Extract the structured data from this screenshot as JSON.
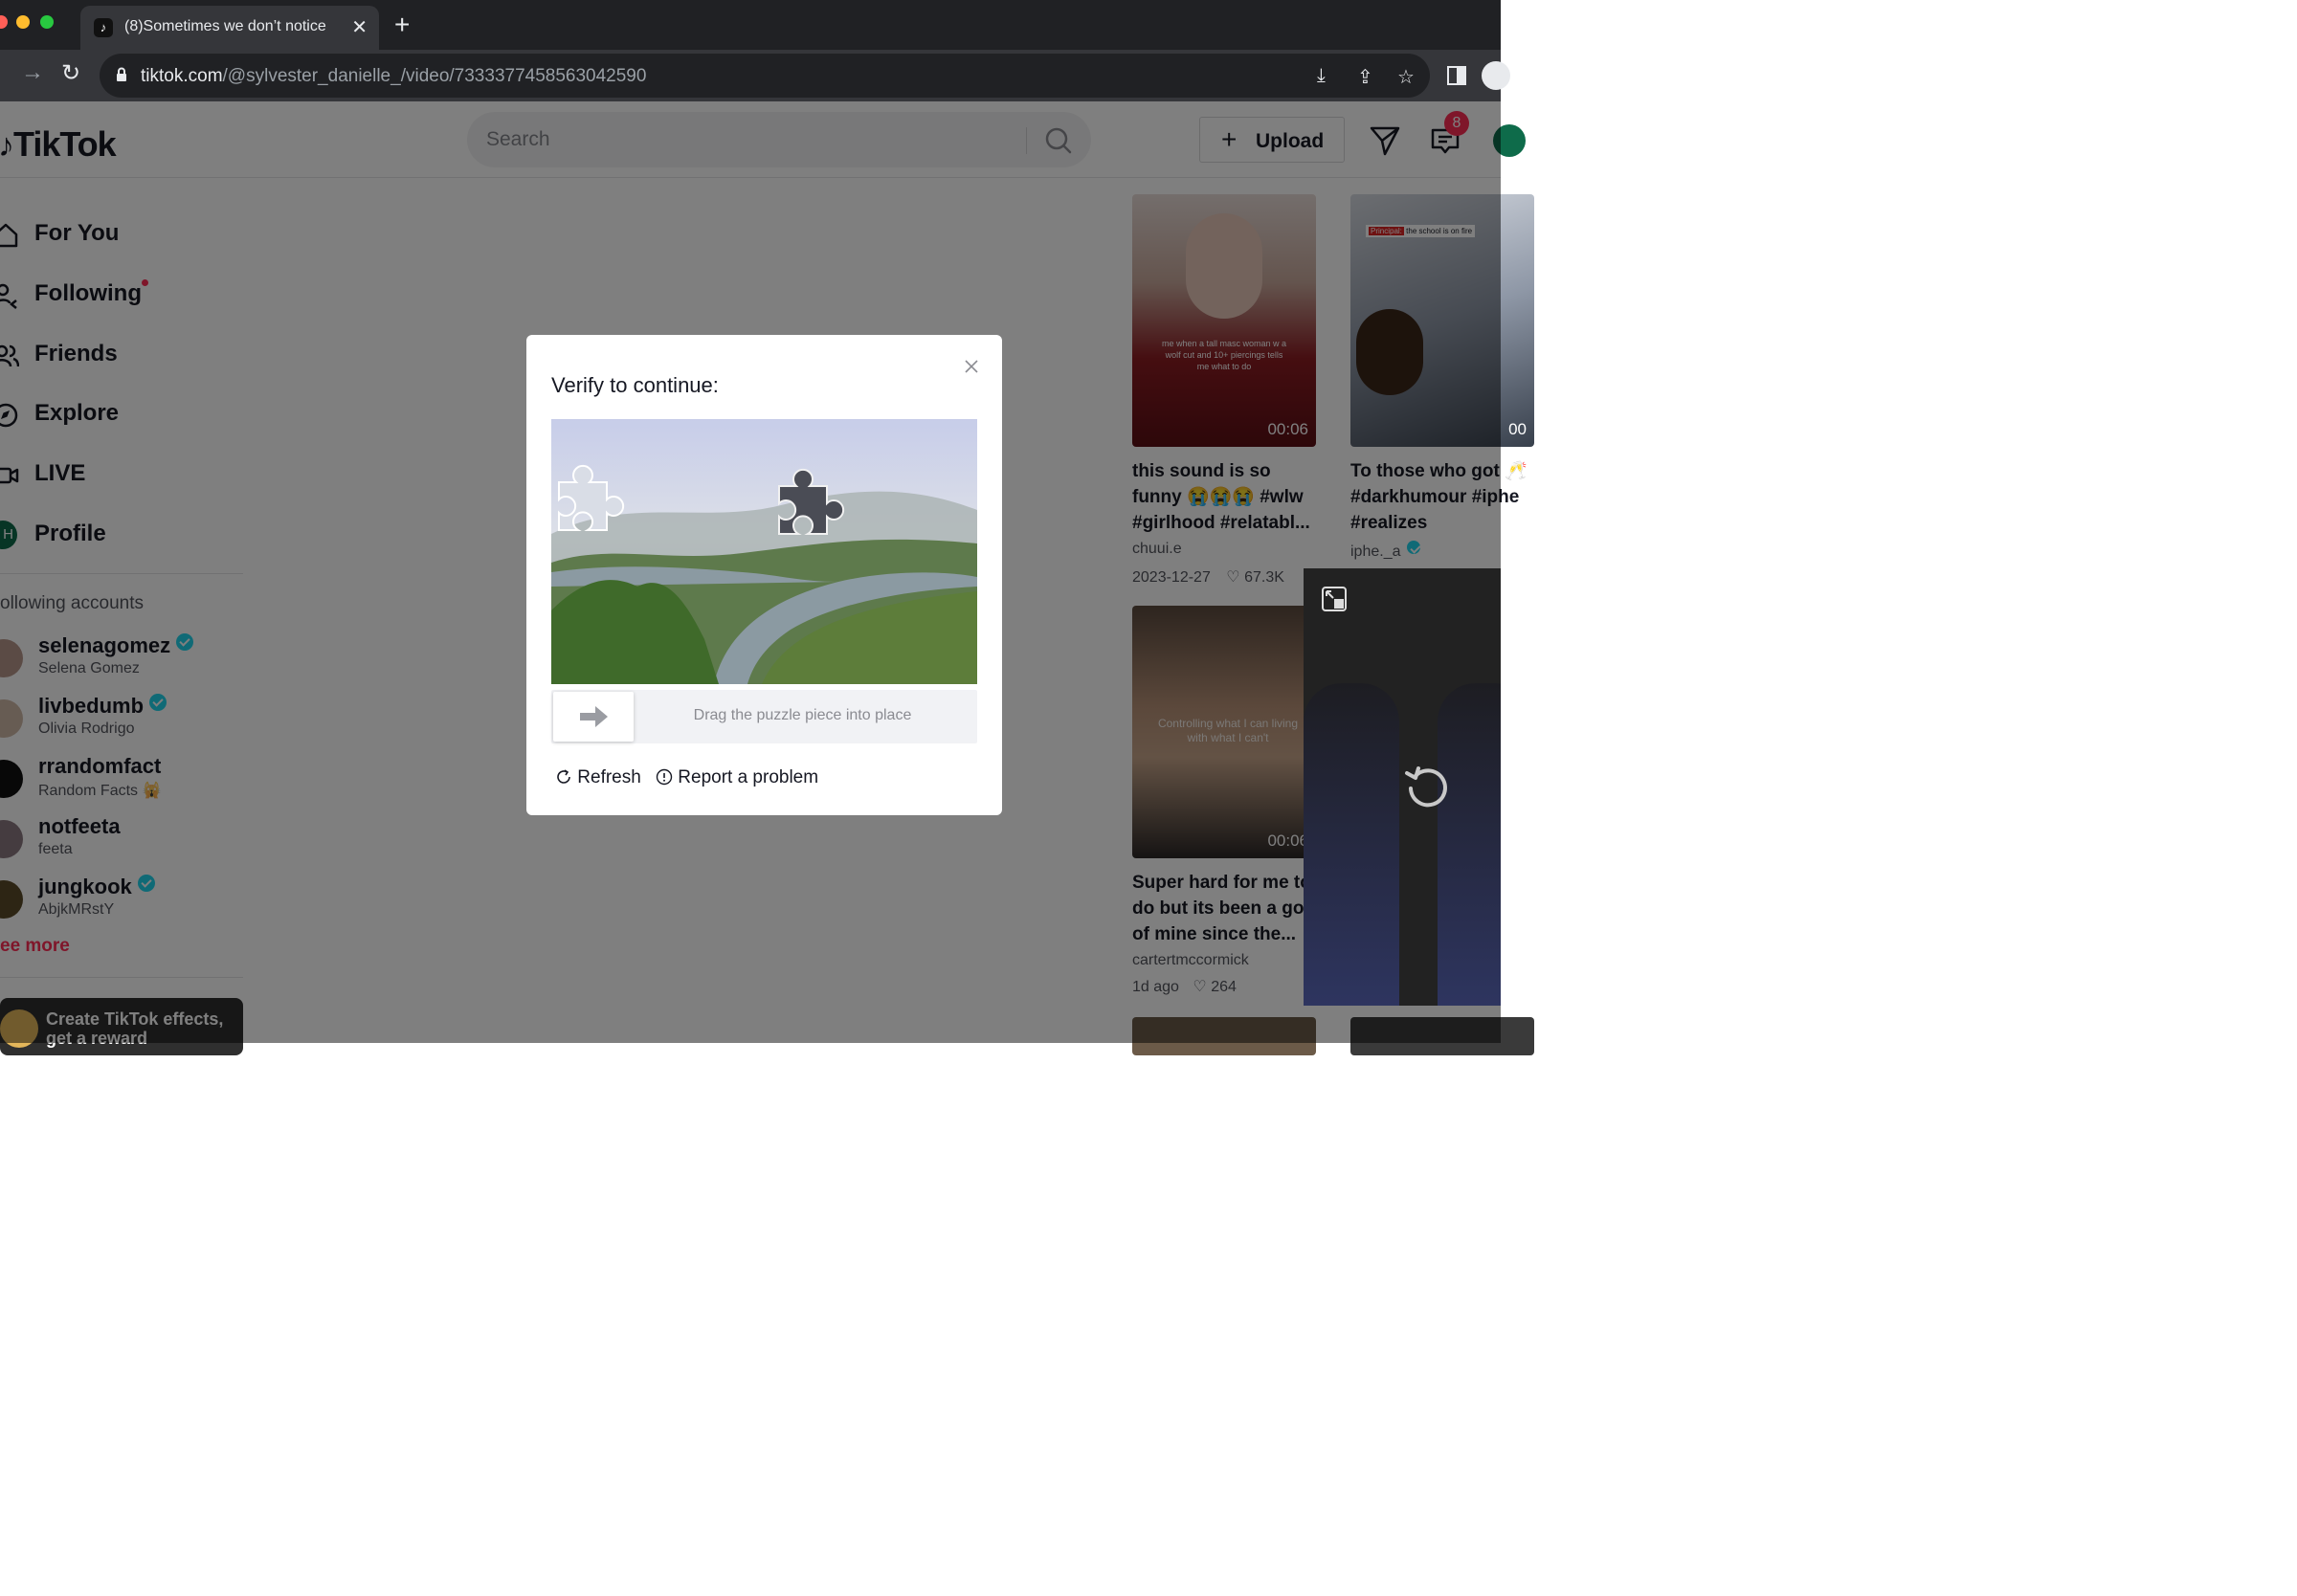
{
  "browser": {
    "tab_title": "(8)Sometimes we don’t notice",
    "url_host": "tiktok.com",
    "url_path": "/@sylvester_danielle_/video/7333377458563042590"
  },
  "header": {
    "logo": "TikTok",
    "search_placeholder": "Search",
    "upload_label": "Upload",
    "inbox_badge": "8"
  },
  "sidebar": {
    "nav": [
      "For You",
      "Following",
      "Friends",
      "Explore",
      "LIVE",
      "Profile"
    ],
    "profile_initial": "H",
    "following_title": "ollowing accounts",
    "accounts": [
      {
        "name": "selenagomez",
        "sub": "Selena Gomez",
        "verified": true
      },
      {
        "name": "livbedumb",
        "sub": "Olivia Rodrigo",
        "verified": true
      },
      {
        "name": "rrandomfact",
        "sub": "Random Facts 🙀",
        "verified": false
      },
      {
        "name": "notfeeta",
        "sub": "feeta",
        "verified": false
      },
      {
        "name": "jungkook",
        "sub": "AbjkMRstY",
        "verified": true
      }
    ],
    "see_more": "ee more",
    "effects_banner": "Create TikTok effects, get a reward"
  },
  "feed": [
    {
      "caption": "this sound is so funny 😭😭😭 #wlw #girlhood #relatabl...",
      "author": "chuui.e",
      "date": "2023-12-27",
      "likes": "67.3K",
      "duration": "00:06",
      "overlay": "me when a tall masc woman w a wolf cut and 10+ piercings tells me what to do"
    },
    {
      "caption": "To those who got 🥂 #darkhumour #iphe #realizes",
      "author": "iphe._a",
      "duration": "00",
      "overlay_tag": "Principal:",
      "overlay_text": "the school is on fire"
    },
    {
      "caption": "Super hard for me to do but its been a goa of mine since the...",
      "author": "cartertmccormick",
      "date": "1d ago",
      "likes": "264",
      "duration": "00:06",
      "overlay": "Controlling what I can living with what I can't"
    }
  ],
  "modal": {
    "title": "Verify to continue:",
    "slider_hint": "Drag the puzzle piece into place",
    "refresh": "Refresh",
    "report": "Report a problem"
  },
  "colors": {
    "brand": "#fe2c55",
    "verified": "#20d5ec"
  }
}
